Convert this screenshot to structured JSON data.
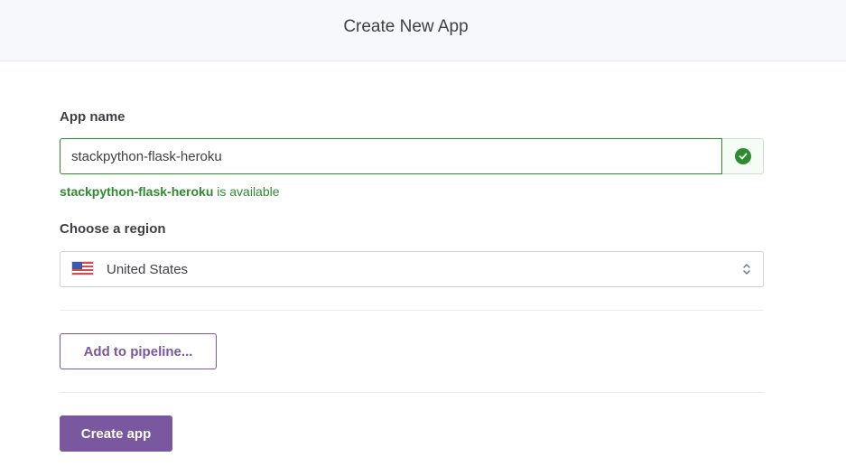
{
  "header": {
    "title": "Create New App"
  },
  "app_name": {
    "label": "App name",
    "value": "stackpython-flask-heroku",
    "status_icon": "check-circle-icon",
    "availability": {
      "name": "stackpython-flask-heroku",
      "suffix": " is available"
    }
  },
  "region": {
    "label": "Choose a region",
    "flag_icon": "us-flag-icon",
    "selected": "United States"
  },
  "actions": {
    "pipeline_label": "Add to pipeline...",
    "create_label": "Create app"
  },
  "colors": {
    "accent": "#79589f",
    "success": "#2e8b2e"
  }
}
